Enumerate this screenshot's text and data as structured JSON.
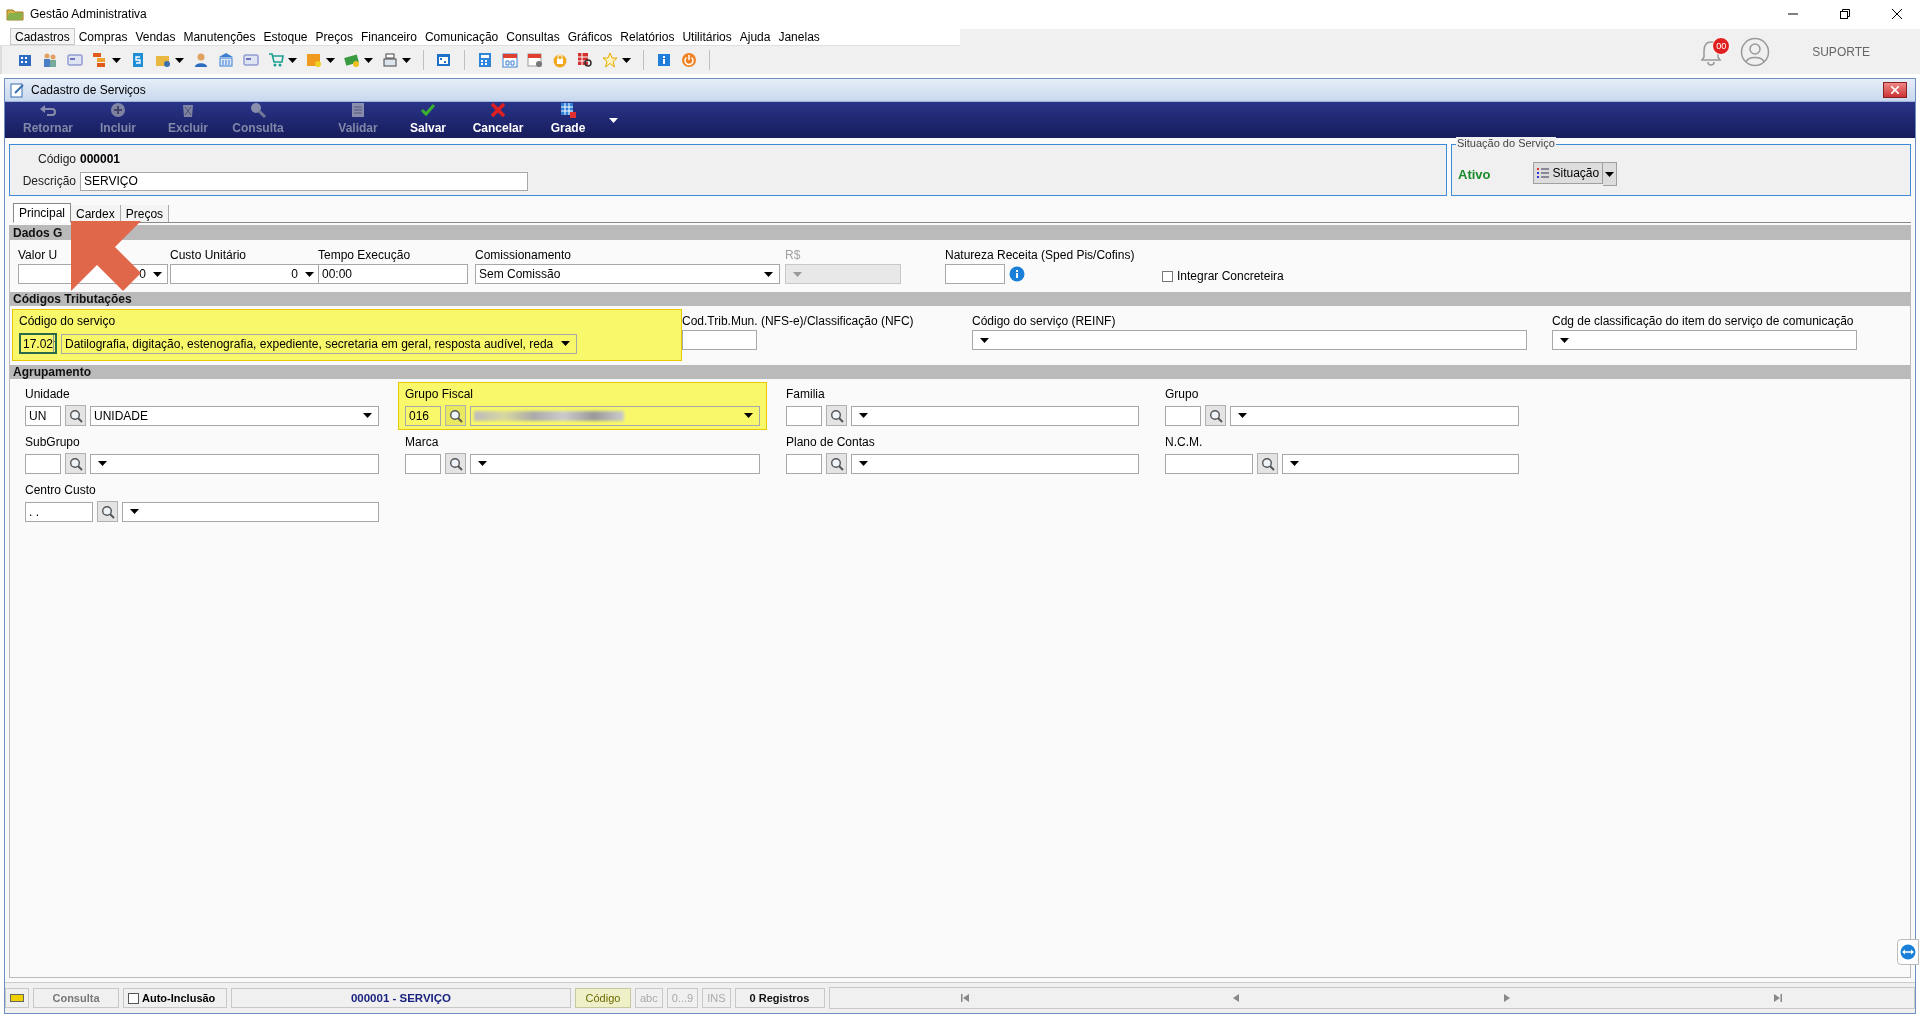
{
  "window": {
    "title": "Gestão Administrativa"
  },
  "menu": [
    {
      "label": "Cadastros",
      "selected": true
    },
    {
      "label": "Compras",
      "selected": false
    },
    {
      "label": "Vendas",
      "selected": false
    },
    {
      "label": "Manutenções",
      "selected": false
    },
    {
      "label": "Estoque",
      "selected": false
    },
    {
      "label": "Preços",
      "selected": false
    },
    {
      "label": "Financeiro",
      "selected": false
    },
    {
      "label": "Comunicação",
      "selected": false
    },
    {
      "label": "Consultas",
      "selected": false
    },
    {
      "label": "Gráficos",
      "selected": false
    },
    {
      "label": "Relatórios",
      "selected": false
    },
    {
      "label": "Utilitários",
      "selected": false
    },
    {
      "label": "Ajuda",
      "selected": false
    },
    {
      "label": "Janelas",
      "selected": false
    }
  ],
  "header": {
    "notification_count": "00",
    "user": "SUPORTE"
  },
  "child_window": {
    "title": "Cadastro de Serviços"
  },
  "actions": [
    {
      "label": "Retornar",
      "disabled": true
    },
    {
      "label": "Incluir",
      "disabled": true
    },
    {
      "label": "Excluir",
      "disabled": true
    },
    {
      "label": "Consulta",
      "disabled": true
    },
    {
      "label": "Validar",
      "disabled": true
    },
    {
      "label": "Salvar",
      "disabled": false
    },
    {
      "label": "Cancelar",
      "disabled": false
    },
    {
      "label": "Grade",
      "disabled": false
    }
  ],
  "record": {
    "code_label": "Código",
    "code": "000001",
    "description_label": "Descrição",
    "description": "SERVIÇO"
  },
  "situacao": {
    "legend": "Situação do Serviço",
    "status": "Ativo",
    "button": "Situação"
  },
  "tabs": [
    {
      "label": "Principal",
      "selected": true
    },
    {
      "label": "Cardex",
      "selected": false
    },
    {
      "label": "Preços",
      "selected": false
    }
  ],
  "sections": [
    {
      "title": "Dados G",
      "fields": [
        {
          "kind": "spin",
          "label": "Valor U",
          "value": "0"
        },
        {
          "kind": "spin",
          "label": "Custo Unitário",
          "value": "0"
        },
        {
          "kind": "text",
          "label": "Tempo Execução",
          "value": "00:00"
        },
        {
          "kind": "combo",
          "label": "Comissionamento",
          "value": "Sem Comissão",
          "disabled": false
        },
        {
          "kind": "combo",
          "label": "R$",
          "disabled": true
        },
        {
          "kind": "info",
          "label": "Natureza Receita (Sped Pis/Cofins)"
        },
        {
          "kind": "checkbox",
          "label": "Integrar Concreteira",
          "checked": false
        }
      ]
    },
    {
      "title": "Códigos Tributações",
      "fields": [
        {
          "kind": "code-combo",
          "label": "Código do serviço",
          "code": "17.02",
          "value": "Datilografia, digitação, estenografia, expediente, secretaria em geral, resposta audível, reda",
          "highlighted": true
        },
        {
          "kind": "text",
          "label": "Cod.Trib.Mun. (NFS-e)/Classificação (NFC)"
        },
        {
          "kind": "combo",
          "label": "Código do serviço (REINF)",
          "disabled": false
        },
        {
          "kind": "combo",
          "label": "Cdg de classificação do item do serviço de comunicação",
          "disabled": false
        }
      ]
    },
    {
      "title": "Agrupamento",
      "fields": [
        {
          "kind": "lookup",
          "label": "Unidade",
          "code": "UN",
          "value": "UNIDADE",
          "highlighted": false
        },
        {
          "kind": "lookup",
          "label": "Grupo Fiscal",
          "code": "016",
          "redacted": true,
          "highlighted": true
        },
        {
          "kind": "lookup",
          "label": "Familia",
          "highlighted": false
        },
        {
          "kind": "lookup",
          "label": "Grupo",
          "highlighted": false
        },
        {
          "kind": "lookup",
          "label": "SubGrupo",
          "highlighted": false
        },
        {
          "kind": "lookup",
          "label": "Marca",
          "highlighted": false
        },
        {
          "kind": "lookup",
          "label": "Plano de Contas",
          "highlighted": false
        },
        {
          "kind": "lookup",
          "label": "N.C.M.",
          "highlighted": false
        },
        {
          "kind": "lookup",
          "label": "Centro Custo",
          "code": ". .",
          "highlighted": false
        }
      ]
    }
  ],
  "status_bar": {
    "mode": "Consulta",
    "auto_inclusion": {
      "label": "Auto-Inclusão",
      "checked": false
    },
    "record": "000001 - SERVIÇO",
    "sort_key": "Código",
    "indicators": [
      "abc",
      "0...9",
      "INS"
    ],
    "count": "0 Registros"
  }
}
